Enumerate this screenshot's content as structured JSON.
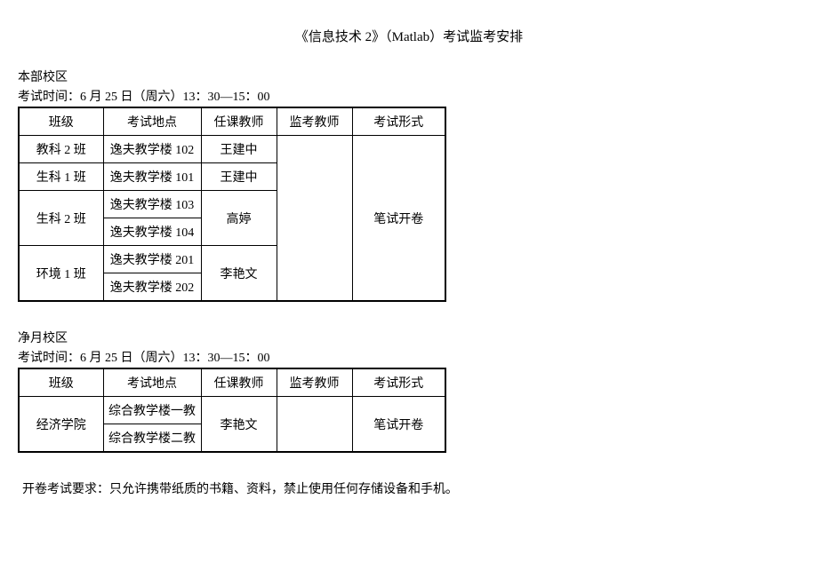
{
  "title": "《信息技术 2》（Matlab）考试监考安排",
  "sections": [
    {
      "campus": "本部校区",
      "examTime": "考试时间：6 月 25 日（周六）13：30—15：00",
      "headers": {
        "class": "班级",
        "location": "考试地点",
        "teacher": "任课教师",
        "proctor": "监考教师",
        "format": "考试形式"
      },
      "examFormat": "笔试开卷",
      "rows": [
        {
          "class": "教科 2 班",
          "locations": [
            "逸夫教学楼 102"
          ],
          "teacher": "王建中"
        },
        {
          "class": "生科 1 班",
          "locations": [
            "逸夫教学楼 101"
          ],
          "teacher": "王建中"
        },
        {
          "class": "生科 2 班",
          "locations": [
            "逸夫教学楼 103",
            "逸夫教学楼 104"
          ],
          "teacher": "高婷"
        },
        {
          "class": "环境 1 班",
          "locations": [
            "逸夫教学楼 201",
            "逸夫教学楼 202"
          ],
          "teacher": "李艳文"
        }
      ]
    },
    {
      "campus": "净月校区",
      "examTime": "考试时间：6 月 25 日（周六）13：30—15：00",
      "headers": {
        "class": "班级",
        "location": "考试地点",
        "teacher": "任课教师",
        "proctor": "监考教师",
        "format": "考试形式"
      },
      "examFormat": "笔试开卷",
      "rows": [
        {
          "class": "经济学院",
          "locations": [
            "综合教学楼一教",
            "综合教学楼二教"
          ],
          "teacher": "李艳文"
        }
      ]
    }
  ],
  "footerNote": "开卷考试要求：只允许携带纸质的书籍、资料，禁止使用任何存储设备和手机。"
}
